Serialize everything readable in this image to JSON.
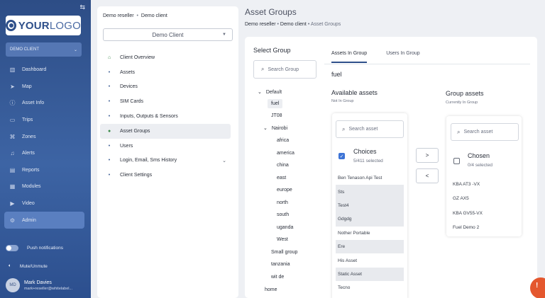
{
  "sidebar": {
    "collapse_icon": "collapse-icon",
    "logo": {
      "main": "YOUR",
      "sub": "LOGO"
    },
    "client_select": "DEMO CLIENT",
    "items": [
      {
        "label": "Dashboard",
        "icon": "chart-icon"
      },
      {
        "label": "Map",
        "icon": "navigation-icon"
      },
      {
        "label": "Asset Info",
        "icon": "info-icon"
      },
      {
        "label": "Trips",
        "icon": "trips-icon"
      },
      {
        "label": "Zones",
        "icon": "zones-icon"
      },
      {
        "label": "Alerts",
        "icon": "bell-icon"
      },
      {
        "label": "Reports",
        "icon": "report-icon"
      },
      {
        "label": "Modules",
        "icon": "modules-icon"
      },
      {
        "label": "Video",
        "icon": "video-icon"
      },
      {
        "label": "Admin",
        "icon": "gear-icon",
        "active": true
      }
    ],
    "push_label": "Push notifications",
    "mute_label": "Mute/Unmute",
    "user": {
      "initials": "MD",
      "name": "Mark Davies",
      "email": "mark+reseller@whitelabel..."
    }
  },
  "client_panel": {
    "breadcrumb": [
      "Demo reseller",
      "Demo client"
    ],
    "client_select": "Demo Client",
    "items": [
      {
        "label": "Client Overview",
        "icon": "home-icon"
      },
      {
        "label": "Assets",
        "icon": "dot"
      },
      {
        "label": "Devices",
        "icon": "dot"
      },
      {
        "label": "SIM Cards",
        "icon": "dot"
      },
      {
        "label": "Inputs, Outputs & Sensors",
        "icon": "dot"
      },
      {
        "label": "Asset Groups",
        "icon": "dot",
        "active": true
      },
      {
        "label": "Users",
        "icon": "dot"
      },
      {
        "label": "Login, Email, Sms History",
        "icon": "dot",
        "has_chevron": true
      },
      {
        "label": "Client Settings",
        "icon": "dot"
      }
    ]
  },
  "main": {
    "title": "Asset Groups",
    "breadcrumb": [
      "Demo reseller",
      "Demo client",
      "Asset Groups"
    ],
    "select_group_title": "Select Group",
    "group_search_placeholder": "Search Group",
    "tree": [
      {
        "label": "Default",
        "toggle": "⌄"
      },
      {
        "label": "fuel",
        "selected": true
      },
      {
        "label": "JT08"
      },
      {
        "label": "Nairobi",
        "toggle": "⌄"
      },
      {
        "label": "africa"
      },
      {
        "label": "america"
      },
      {
        "label": "china"
      },
      {
        "label": "east"
      },
      {
        "label": "europe"
      },
      {
        "label": "north"
      },
      {
        "label": "south"
      },
      {
        "label": "uganda"
      },
      {
        "label": "West"
      },
      {
        "label": "Small group"
      },
      {
        "label": "tanzania"
      },
      {
        "label": "wit de"
      },
      {
        "label": "home"
      }
    ],
    "tabs": [
      "Assets In Group",
      "Users In Group"
    ],
    "group_name": "fuel",
    "available": {
      "title": "Available assets",
      "subtitle": "Not In Group",
      "search_placeholder": "Search asset",
      "choices_title": "Choices",
      "choices_count": "5/411 selected",
      "items": [
        {
          "label": "Ben Tenason Api Test",
          "selected": false
        },
        {
          "label": "Sts",
          "selected": true
        },
        {
          "label": "Test4",
          "selected": true
        },
        {
          "label": "Gdgdg",
          "selected": true
        },
        {
          "label": "Nother Portable",
          "selected": false
        },
        {
          "label": "Ere",
          "selected": true
        },
        {
          "label": "His Asset",
          "selected": false
        },
        {
          "label": "Static Asset",
          "selected": true
        },
        {
          "label": "Tecno",
          "selected": false
        }
      ]
    },
    "move_right": ">",
    "move_left": "<",
    "group_assets": {
      "title": "Group assets",
      "subtitle": "Currently In Group",
      "search_placeholder": "Search asset",
      "chosen_title": "Chosen",
      "chosen_count": "0/4 selected",
      "items": [
        "KBA AT3 -VX",
        "GZ AX5",
        "KBA GV55-VX",
        "Fuel Demo 2"
      ]
    },
    "help_label": "!"
  }
}
